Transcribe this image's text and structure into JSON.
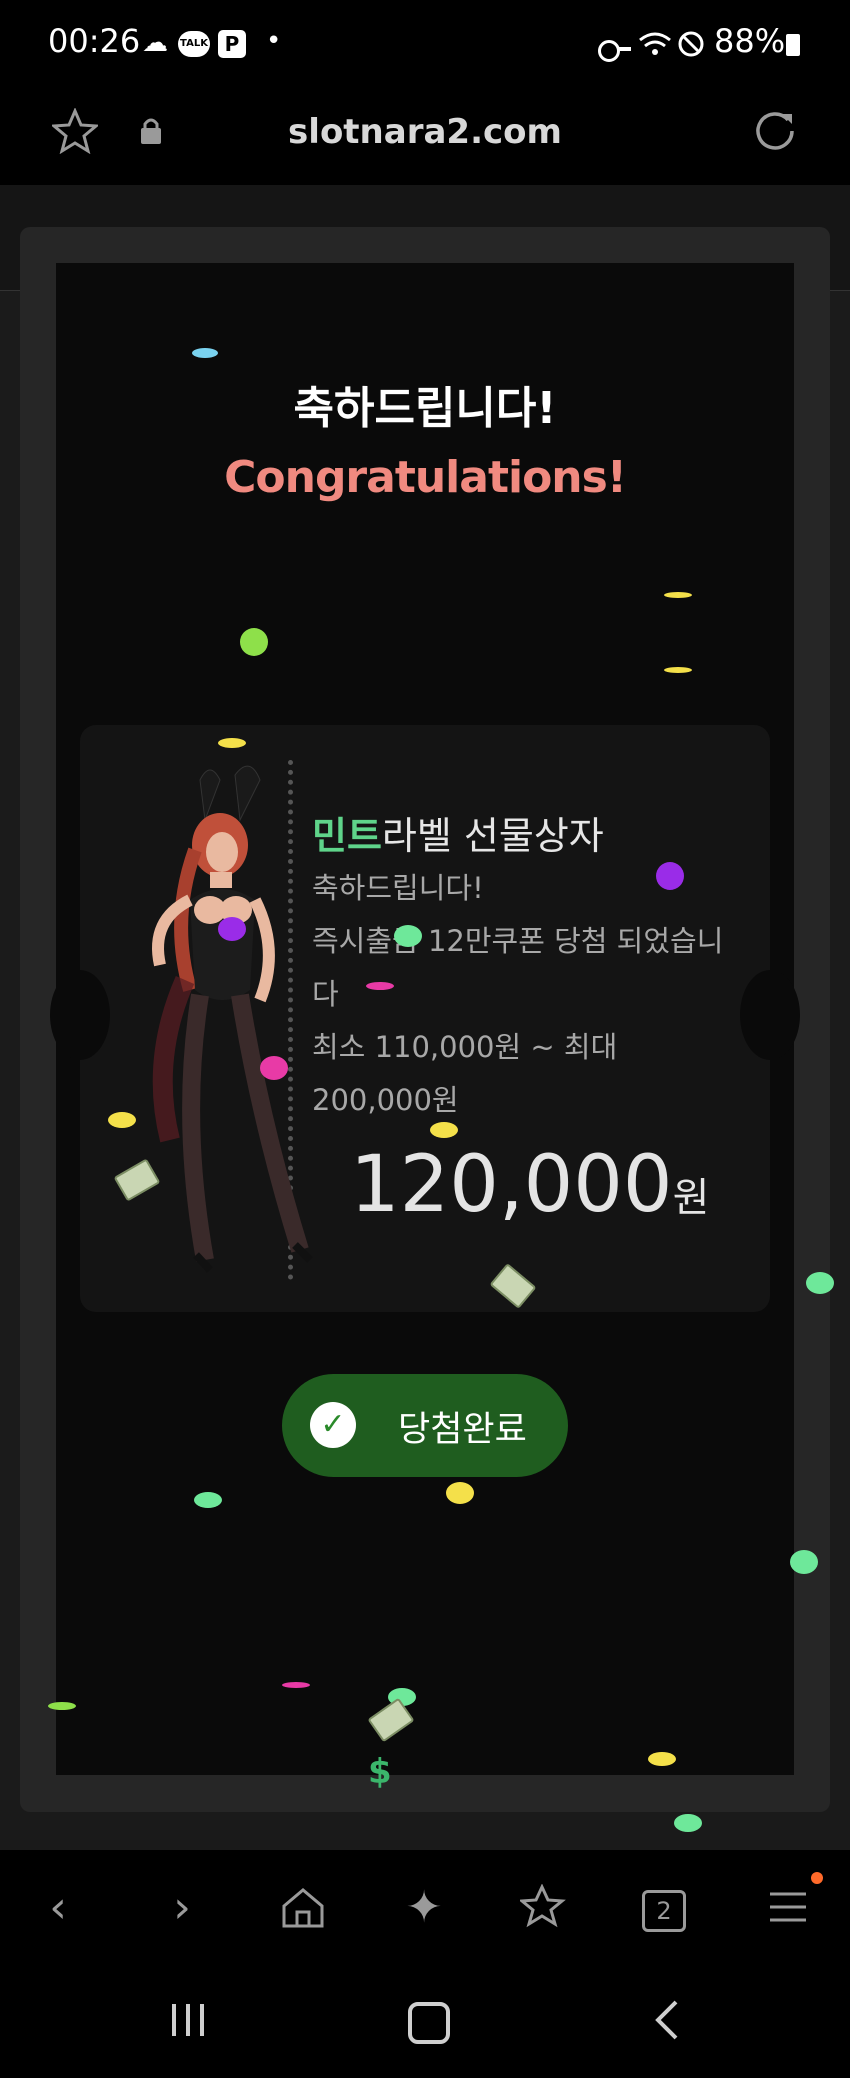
{
  "status_bar": {
    "time": "00:26",
    "icons": [
      "cloud-icon",
      "kakaotalk-icon",
      "p-icon",
      "dot-icon",
      "key-icon",
      "wifi-icon",
      "blocked-icon"
    ],
    "battery": "88%"
  },
  "url_bar": {
    "url": "slotnara2.com",
    "icons": [
      "star-icon",
      "lock-icon",
      "reload-icon"
    ]
  },
  "modal": {
    "title_ko": "축하드립니다!",
    "title_en": "Congratulations!",
    "coupon": {
      "title_accent": "민트",
      "title_rest": "라벨 선물상자",
      "line1": "축하드립니다!",
      "line2": "즉시출금 12만쿠폰 당첨 되었습니다",
      "line3": "최소 110,000원 ~ 최대 200,000원",
      "amount": "120,000",
      "amount_unit": "원"
    },
    "button_label": "당첨완료",
    "dollar_sign": "$"
  },
  "browser_toolbar": {
    "tabs_count": "2",
    "items": [
      "back-icon",
      "forward-icon",
      "home-icon",
      "sparkle-icon",
      "bookmarks-icon",
      "tabs-icon",
      "menu-icon"
    ]
  },
  "colors": {
    "accent_mint": "#5fd48a",
    "title_en": "#f08a80",
    "button_bg": "#1f5d1f",
    "notification_dot": "#ff6a2a"
  }
}
